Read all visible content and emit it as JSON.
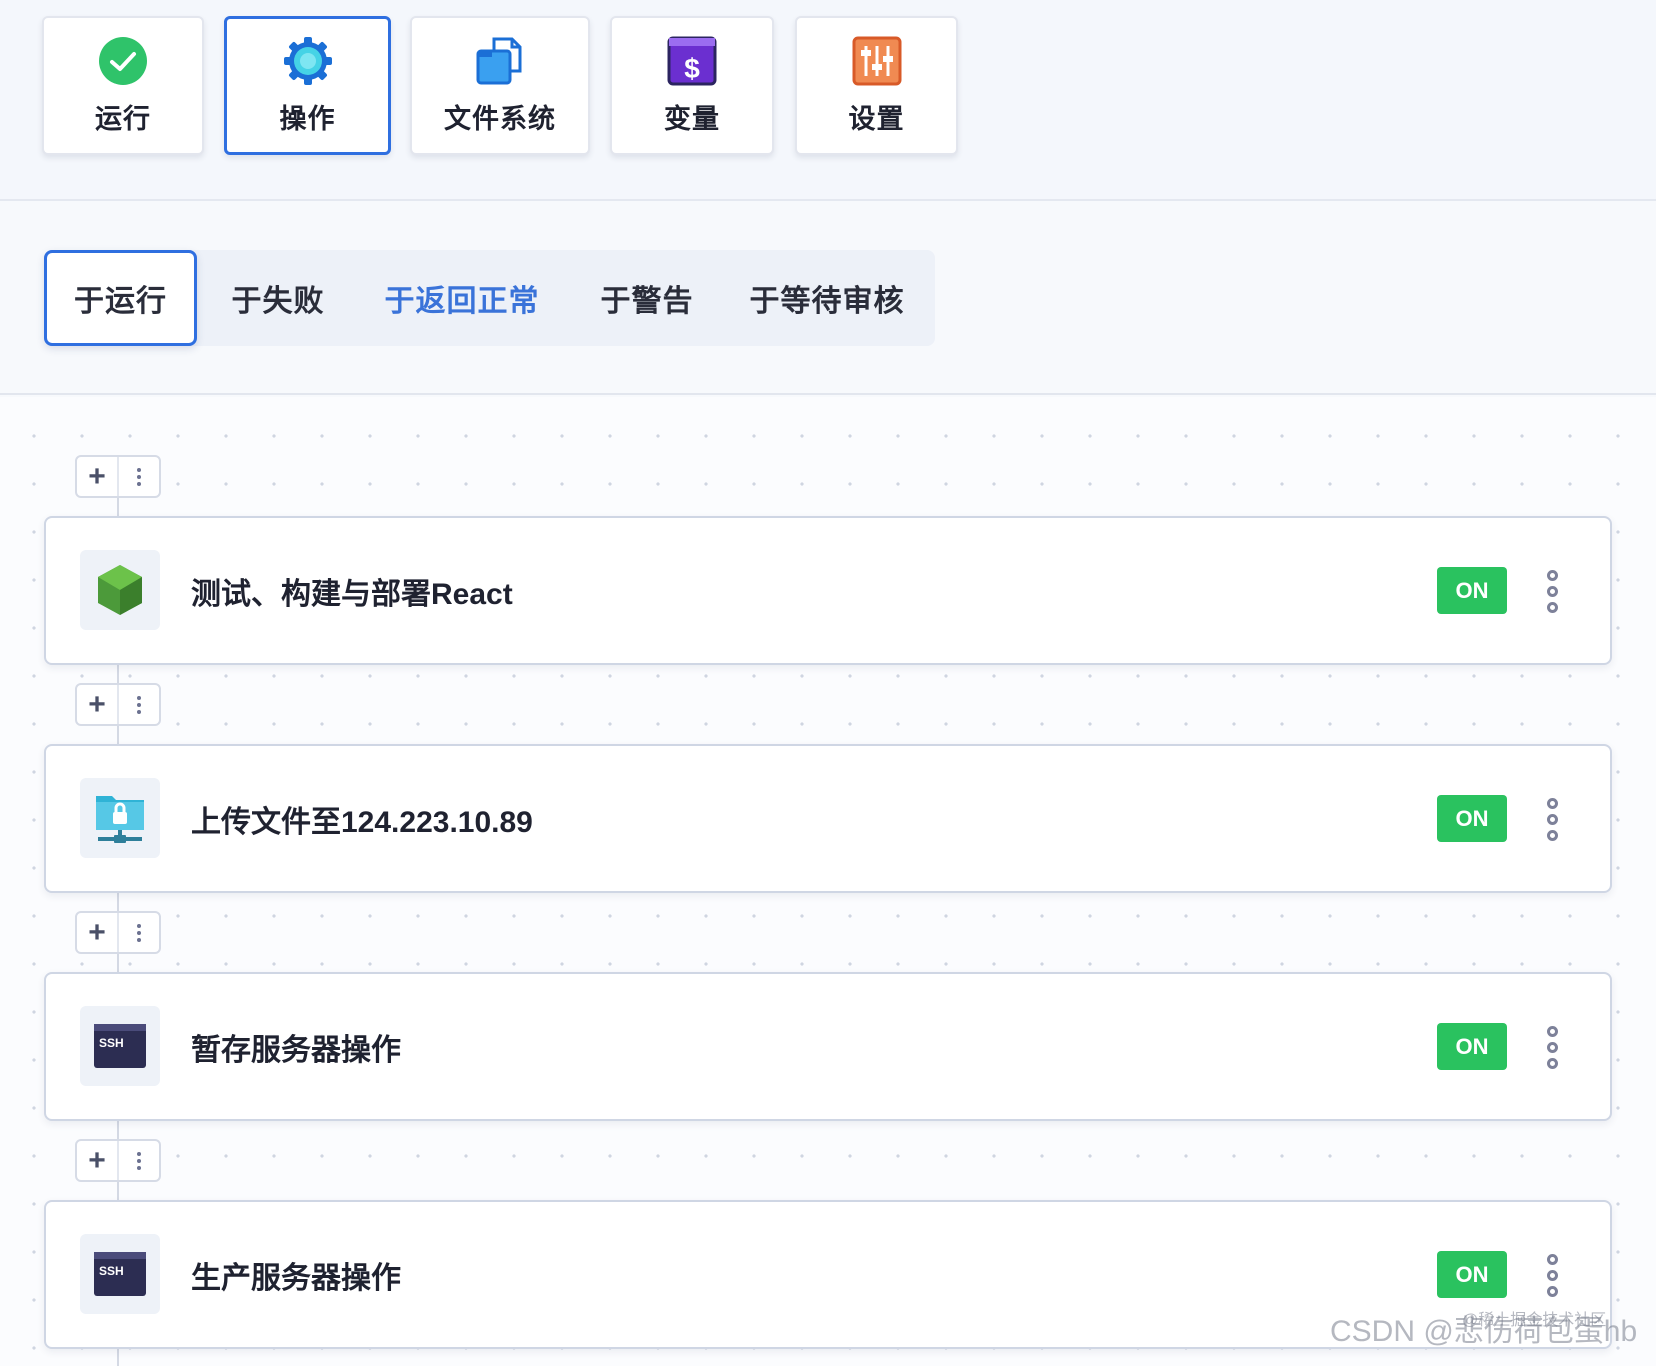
{
  "toolbar": {
    "buttons": [
      {
        "label": "运行",
        "icon": "check-circle-icon",
        "active": false
      },
      {
        "label": "操作",
        "icon": "gear-icon",
        "active": true
      },
      {
        "label": "文件系统",
        "icon": "files-icon",
        "active": false
      },
      {
        "label": "变量",
        "icon": "dollar-variable-icon",
        "active": false
      },
      {
        "label": "设置",
        "icon": "sliders-icon",
        "active": false
      }
    ]
  },
  "tabs": [
    {
      "label": "于运行",
      "selected": true
    },
    {
      "label": "于失败",
      "selected": false
    },
    {
      "label": "于返回正常",
      "selected": false,
      "highlight": true
    },
    {
      "label": "于警告",
      "selected": false
    },
    {
      "label": "于等待审核",
      "selected": false
    }
  ],
  "actions": [
    {
      "title": "测试、构建与部署React",
      "icon": "nodejs-hexagon-icon",
      "toggle": "ON"
    },
    {
      "title": "上传文件至124.223.10.89",
      "icon": "secure-ftp-server-icon",
      "toggle": "ON"
    },
    {
      "title": "暂存服务器操作",
      "icon": "ssh-terminal-icon",
      "toggle": "ON",
      "icon_text": "SSH"
    },
    {
      "title": "生产服务器操作",
      "icon": "ssh-terminal-icon",
      "toggle": "ON",
      "icon_text": "SSH"
    }
  ],
  "add_control": {
    "plus": "+"
  },
  "watermark": {
    "main": "CSDN @悲伤荷包蛋hb",
    "sub": "@稀土掘金技术社区"
  },
  "colors": {
    "accent": "#2f6fe0",
    "highlight_tab": "#3a73d9",
    "toggle_on": "#2ac25f",
    "ok_green": "#2fc36a",
    "ssh_dark": "#2c2d52"
  }
}
